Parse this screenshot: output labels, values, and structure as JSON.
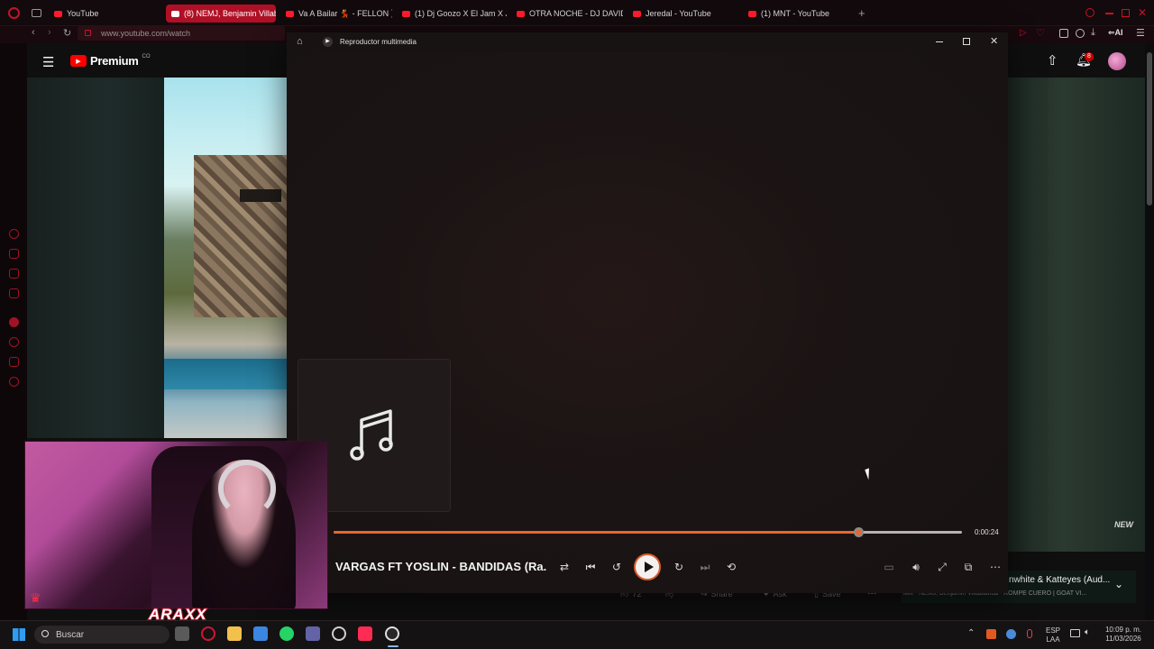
{
  "browser": {
    "tabs": [
      {
        "label": "YouTube",
        "active": false
      },
      {
        "label": "(8) NEMJ, Benjamin Villab",
        "active": true
      },
      {
        "label": "Va A Bailar 💃 - FELLON ❌",
        "active": false
      },
      {
        "label": "(1) Dj Goozo X El Jam X Ja",
        "active": false
      },
      {
        "label": "OTRA NOCHE - DJ DAVID",
        "active": false
      },
      {
        "label": "Jeredal - YouTube",
        "active": false
      },
      {
        "label": "(1) MNT - YouTube",
        "active": false
      }
    ],
    "new_tab_label": "+",
    "url": "www.youtube.com/watch",
    "ai_label": "AI"
  },
  "youtube": {
    "logo_text": "Premium",
    "logo_region": "CO",
    "notifications_count": "8",
    "watermark": "NEW",
    "upnext_title": "nwhite & Katteyes (Aud...",
    "upnext_subtitle": "Mix - NEMJ, Benjamin Villabianca - ROMPE CUERO | GOAT VI...",
    "action_like_count": "72",
    "action_share": "Share",
    "action_ask": "Ask",
    "action_save": "Save"
  },
  "player": {
    "window_title": "Reproductor multimedia",
    "track_title": "VARGAS FT YOSLIN - BANDIDAS (Ra...",
    "elapsed": "0:00:24",
    "progress": 0.835,
    "accent": "#e8672c"
  },
  "webcam": {
    "overlay_name": "ARAXX"
  },
  "taskbar": {
    "search_placeholder": "Buscar",
    "lang_top": "ESP",
    "lang_bottom": "LAA",
    "time": "10:09 p. m.",
    "date": "11/03/2026"
  }
}
